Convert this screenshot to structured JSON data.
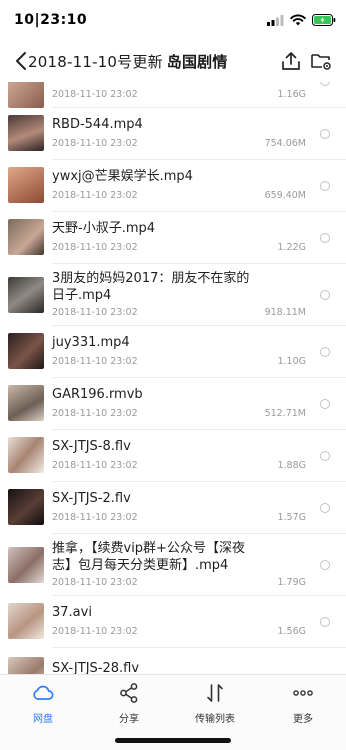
{
  "status_bar": {
    "time": "10|23:10",
    "battery_color": "#34c759"
  },
  "nav": {
    "title": "2018-11-10号更新",
    "folder": "岛国剧情",
    "back_icon": "chevron-left-icon",
    "upload_icon": "upload-icon",
    "folder_icon": "folder-settings-icon"
  },
  "files": [
    {
      "name": "",
      "date": "2018-11-10 23:02",
      "size": "1.16G"
    },
    {
      "name": "RBD-544.mp4",
      "date": "2018-11-10 23:02",
      "size": "754.06M"
    },
    {
      "name": "ywxj@芒果娱学长.mp4",
      "date": "2018-11-10 23:02",
      "size": "659.40M"
    },
    {
      "name": "天野-小叔子.mp4",
      "date": "2018-11-10 23:02",
      "size": "1.22G"
    },
    {
      "name": "3朋友的妈妈2017：朋友不在家的日子.mp4",
      "name_line1": "3朋友的妈妈2017：朋友不在家的",
      "name_line2": "日子.mp4",
      "date": "2018-11-10 23:02",
      "size": "918.11M"
    },
    {
      "name": "juy331.mp4",
      "date": "2018-11-10 23:02",
      "size": "1.10G"
    },
    {
      "name": "GAR196.rmvb",
      "date": "2018-11-10 23:02",
      "size": "512.71M"
    },
    {
      "name": "SX-JTJS-8.flv",
      "date": "2018-11-10 23:02",
      "size": "1.88G"
    },
    {
      "name": "SX-JTJS-2.flv",
      "date": "2018-11-10 23:02",
      "size": "1.57G"
    },
    {
      "name": "推拿，【续费vip群+公众号【深夜志】包月每天分类更新】.mp4",
      "name_line1": "推拿，【续费vip群+公众号【深夜",
      "name_line2": "志】包月每天分类更新】.mp4",
      "date": "2018-11-10 23:02",
      "size": "1.79G"
    },
    {
      "name": "37.avi",
      "date": "2018-11-10 23:02",
      "size": "1.56G"
    },
    {
      "name": "SX-JTJS-28.flv",
      "date": "",
      "size": ""
    }
  ],
  "tabs": [
    {
      "label": "网盘",
      "icon": "cloud-icon",
      "active": true
    },
    {
      "label": "分享",
      "icon": "share-icon",
      "active": false
    },
    {
      "label": "传输列表",
      "icon": "transfer-icon",
      "active": false
    },
    {
      "label": "更多",
      "icon": "more-icon",
      "active": false
    }
  ],
  "colors": {
    "accent": "#2f7df6",
    "text": "#1f1f1f",
    "meta": "#9a9a9a"
  }
}
